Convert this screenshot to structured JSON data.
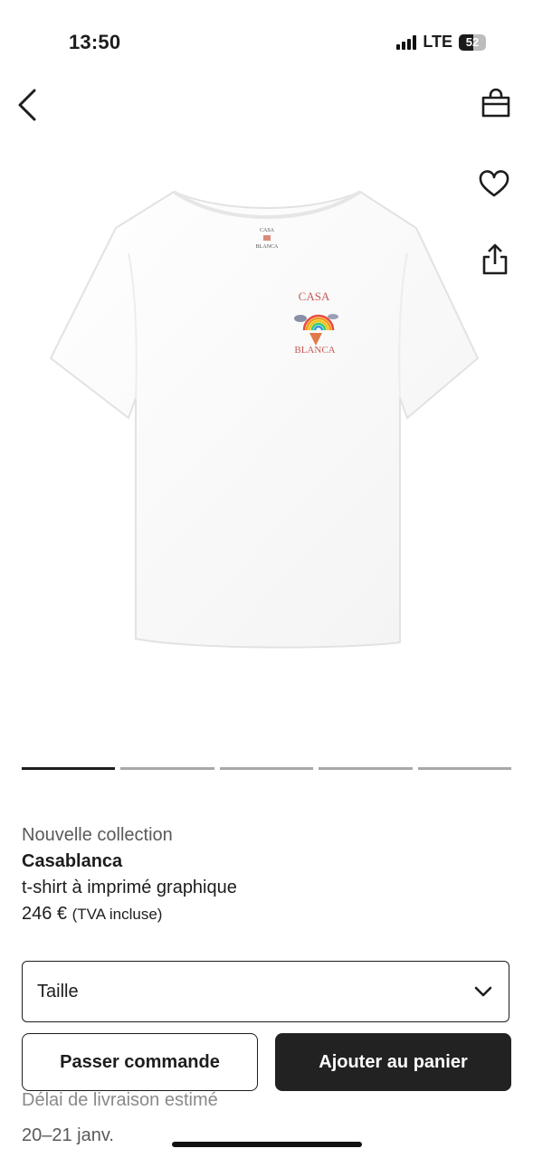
{
  "status_bar": {
    "time": "13:50",
    "network": "LTE",
    "battery_level": "52",
    "signal_bars": 4
  },
  "header": {
    "back_icon": "chevron-left-icon",
    "bag_icon": "shopping-bag-icon",
    "wishlist_icon": "heart-icon",
    "share_icon": "share-icon"
  },
  "product": {
    "image_print_top": "CASA",
    "image_print_bottom": "BLANCA",
    "tag": "Nouvelle collection",
    "brand": "Casablanca",
    "name": "t-shirt à imprimé graphique",
    "price": "246 €",
    "tax_note": "(TVA incluse)"
  },
  "carousel": {
    "total": 5,
    "active_index": 0
  },
  "size_selector": {
    "label": "Taille",
    "icon": "chevron-down-icon"
  },
  "actions": {
    "order_label": "Passer commande",
    "add_to_cart_label": "Ajouter au panier"
  },
  "delivery": {
    "label": "Délai de livraison estimé",
    "dates": "20–21 janv."
  },
  "colors": {
    "primary_button": "#222222",
    "text": "#1d1d1d",
    "muted_text": "#5a5a5a"
  }
}
